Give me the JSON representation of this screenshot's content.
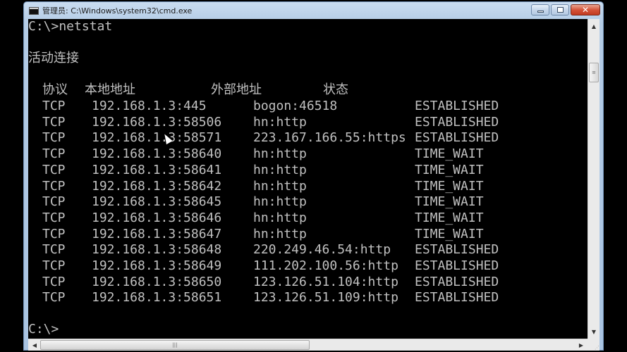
{
  "window": {
    "title": "管理员: C:\\Windows\\system32\\cmd.exe",
    "buttons": {
      "minimize": "minimize",
      "maximize": "maximize",
      "close": "✕"
    }
  },
  "console": {
    "command_line": "C:\\>netstat",
    "section_title": "活动连接",
    "headers": {
      "proto": "协议",
      "local": "本地地址",
      "foreign": "外部地址",
      "state": "状态"
    },
    "rows": [
      {
        "proto": "TCP",
        "local": "192.168.1.3:445",
        "foreign": "bogon:46518",
        "state": "ESTABLISHED"
      },
      {
        "proto": "TCP",
        "local": "192.168.1.3:58506",
        "foreign": "hn:http",
        "state": "ESTABLISHED"
      },
      {
        "proto": "TCP",
        "local": "192.168.1.3:58571",
        "foreign": "223.167.166.55:https",
        "state": "ESTABLISHED"
      },
      {
        "proto": "TCP",
        "local": "192.168.1.3:58640",
        "foreign": "hn:http",
        "state": "TIME_WAIT"
      },
      {
        "proto": "TCP",
        "local": "192.168.1.3:58641",
        "foreign": "hn:http",
        "state": "TIME_WAIT"
      },
      {
        "proto": "TCP",
        "local": "192.168.1.3:58642",
        "foreign": "hn:http",
        "state": "TIME_WAIT"
      },
      {
        "proto": "TCP",
        "local": "192.168.1.3:58645",
        "foreign": "hn:http",
        "state": "TIME_WAIT"
      },
      {
        "proto": "TCP",
        "local": "192.168.1.3:58646",
        "foreign": "hn:http",
        "state": "TIME_WAIT"
      },
      {
        "proto": "TCP",
        "local": "192.168.1.3:58647",
        "foreign": "hn:http",
        "state": "TIME_WAIT"
      },
      {
        "proto": "TCP",
        "local": "192.168.1.3:58648",
        "foreign": "220.249.46.54:http",
        "state": "ESTABLISHED"
      },
      {
        "proto": "TCP",
        "local": "192.168.1.3:58649",
        "foreign": "111.202.100.56:http",
        "state": "ESTABLISHED"
      },
      {
        "proto": "TCP",
        "local": "192.168.1.3:58650",
        "foreign": "123.126.51.104:http",
        "state": "ESTABLISHED"
      },
      {
        "proto": "TCP",
        "local": "192.168.1.3:58651",
        "foreign": "123.126.51.109:http",
        "state": "ESTABLISHED"
      }
    ],
    "prompt": "C:\\>"
  },
  "scrollbars": {
    "up_arrow": "▲",
    "down_arrow": "▼",
    "left_arrow": "◀",
    "right_arrow": "▶",
    "grip": "≡"
  }
}
